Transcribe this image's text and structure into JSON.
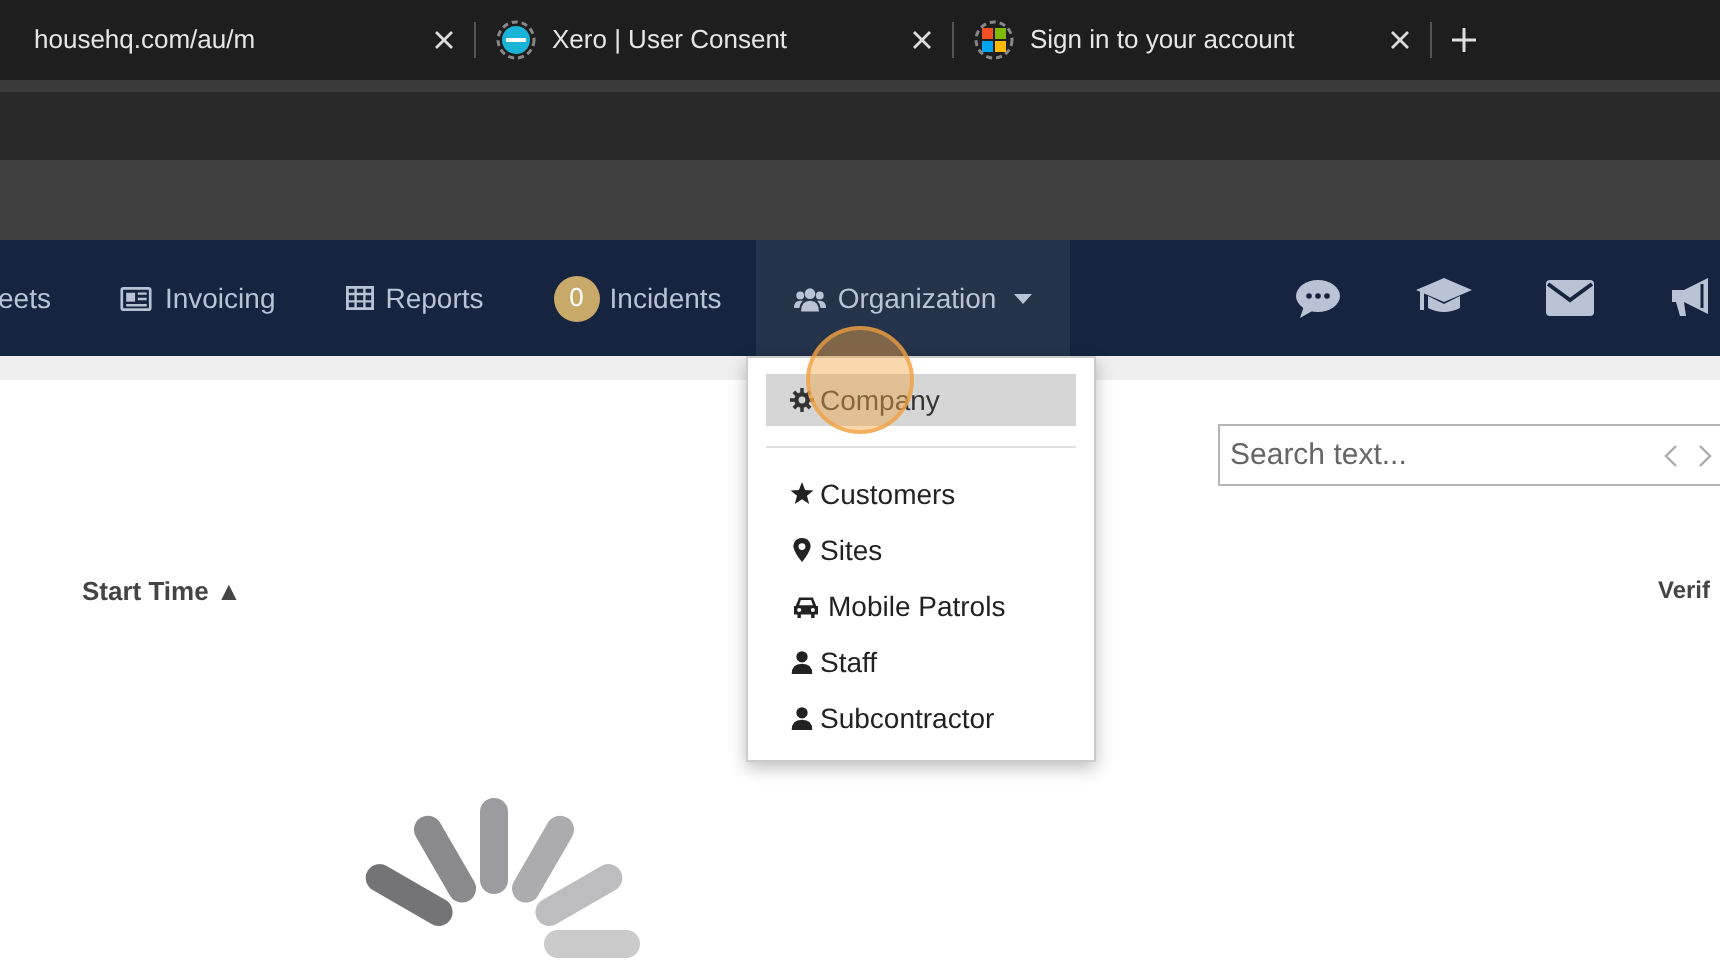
{
  "browser_tabs": [
    {
      "title": "househq.com/au/m",
      "kind": "none"
    },
    {
      "title": "Xero | User Consent",
      "kind": "xero"
    },
    {
      "title": "Sign in to your account",
      "kind": "windows"
    }
  ],
  "nav": {
    "items": [
      {
        "label": "eets",
        "kind": "plain"
      },
      {
        "label": "Invoicing",
        "kind": "invoice"
      },
      {
        "label": "Reports",
        "kind": "table"
      },
      {
        "label": "Incidents",
        "kind": "badge",
        "badge": "0"
      },
      {
        "label": "Organization",
        "kind": "users",
        "expanded": true
      }
    ],
    "right_icons": [
      {
        "kind": "chat"
      },
      {
        "kind": "cap"
      },
      {
        "kind": "mail"
      },
      {
        "kind": "megaphone"
      }
    ]
  },
  "dropdown": {
    "items": [
      {
        "label": "Company",
        "kind": "gear",
        "selected": true,
        "divider_after": true
      },
      {
        "label": "Customers",
        "kind": "star",
        "selected": false
      },
      {
        "label": "Sites",
        "kind": "pin",
        "selected": false
      },
      {
        "label": "Mobile Patrols",
        "kind": "car",
        "selected": false
      },
      {
        "label": "Staff",
        "kind": "user",
        "selected": false
      },
      {
        "label": "Subcontractor",
        "kind": "user",
        "selected": false
      }
    ]
  },
  "search": {
    "placeholder": "Search text..."
  },
  "table": {
    "columns": [
      "Start Time ▲",
      "Verif"
    ]
  },
  "loading": true
}
